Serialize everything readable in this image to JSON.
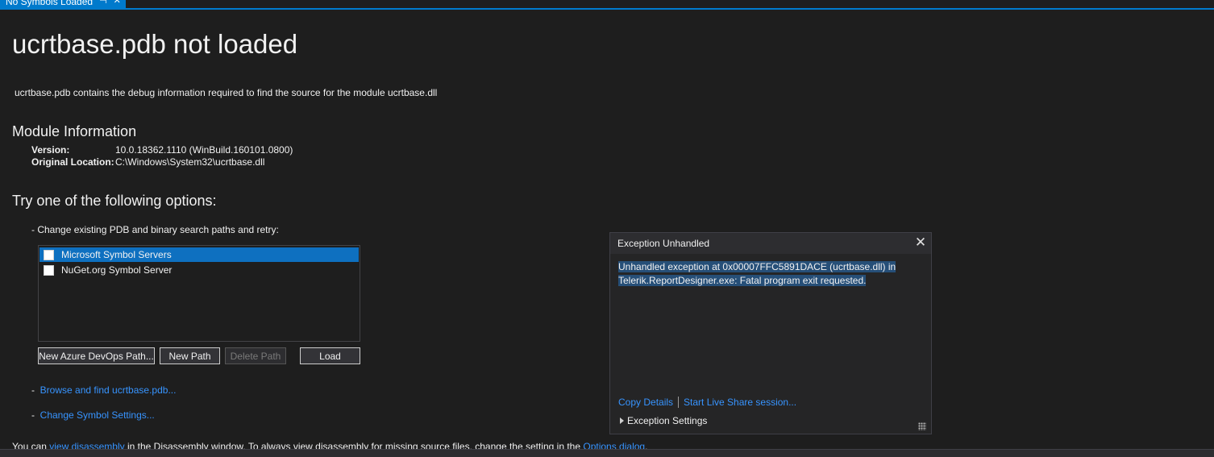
{
  "tab": {
    "label": "No Symbols Loaded",
    "pin_glyph": "⊣",
    "close_glyph": "✕"
  },
  "page": {
    "title": "ucrtbase.pdb not loaded",
    "description": "ucrtbase.pdb contains the debug information required to find the source for the module ucrtbase.dll"
  },
  "module_info": {
    "heading": "Module Information",
    "version_label": "Version:",
    "version_value": "10.0.18362.1110 (WinBuild.160101.0800)",
    "location_label": "Original Location:",
    "location_value": "C:\\Windows\\System32\\ucrtbase.dll"
  },
  "options": {
    "heading": "Try one of the following options:",
    "change_paths": "-  Change existing PDB and binary search paths and retry:",
    "servers": [
      {
        "label": "Microsoft Symbol Servers",
        "checked": false,
        "selected": true
      },
      {
        "label": "NuGet.org Symbol Server",
        "checked": false,
        "selected": false
      }
    ],
    "buttons": {
      "new_azure": "New Azure DevOps Path...",
      "new_path": "New Path",
      "delete_path": "Delete Path",
      "load": "Load"
    },
    "dash": "-",
    "browse_link": "Browse and find ucrtbase.pdb...",
    "settings_link": "Change Symbol Settings..."
  },
  "footer": {
    "pre": "You can ",
    "link1": "view disassembly",
    "mid": " in the Disassembly window. To always view disassembly for missing source files, change the setting in the ",
    "link2": "Options dialog",
    "post": "."
  },
  "exception": {
    "title": "Exception Unhandled",
    "close_glyph": "✕",
    "line1": "Unhandled exception at 0x00007FFC5891DACE (ucrtbase.dll) in",
    "line2": "Telerik.ReportDesigner.exe: Fatal program exit requested.",
    "copy_details": "Copy Details",
    "live_share": "Start Live Share session...",
    "exception_settings": "Exception Settings"
  },
  "colors": {
    "accent": "#007acc",
    "link": "#3794ff",
    "selection": "#0e70c0",
    "background": "#1e1e1e"
  }
}
